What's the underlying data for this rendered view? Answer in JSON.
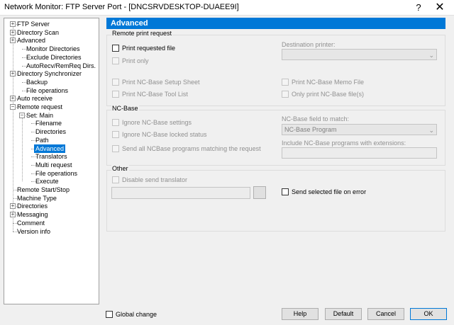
{
  "window": {
    "title": "Network Monitor: FTP Server Port - [DNCSRVDESKTOP-DUAEE9I]",
    "help_glyph": "?",
    "close_glyph": "✕"
  },
  "tree": {
    "items": [
      {
        "label": "FTP Server",
        "expander": "+"
      },
      {
        "label": "Directory Scan",
        "expander": "+"
      },
      {
        "label": "Advanced",
        "expander": "+"
      },
      {
        "label": "Monitor Directories"
      },
      {
        "label": "Exclude Directories"
      },
      {
        "label": "AutoRecv/RemReq Dirs."
      },
      {
        "label": "Directory Synchronizer",
        "expander": "+"
      },
      {
        "label": "Backup"
      },
      {
        "label": "File operations"
      },
      {
        "label": "Auto receive",
        "expander": "+"
      },
      {
        "label": "Remote request",
        "expander": "−"
      },
      {
        "label": "Set: Main",
        "expander": "−"
      },
      {
        "label": "Filename"
      },
      {
        "label": "Directories"
      },
      {
        "label": "Path"
      },
      {
        "label": "Advanced",
        "selected": true
      },
      {
        "label": "Translators"
      },
      {
        "label": "Multi request"
      },
      {
        "label": "File operations"
      },
      {
        "label": "Execute"
      },
      {
        "label": "Remote Start/Stop"
      },
      {
        "label": "Machine Type"
      },
      {
        "label": "Directories",
        "expander": "+"
      },
      {
        "label": "Messaging",
        "expander": "+"
      },
      {
        "label": "Comment"
      },
      {
        "label": "Version info"
      }
    ]
  },
  "panel": {
    "header": "Advanced",
    "remote_print": {
      "title": "Remote print request",
      "print_requested_file": "Print requested file",
      "print_only": "Print only",
      "destination_printer_label": "Destination printer:",
      "destination_printer_value": "",
      "print_setup_sheet": "Print NC-Base Setup Sheet",
      "print_memo_file": "Print NC-Base Memo File",
      "print_tool_list": "Print NC-Base Tool List",
      "only_print_files": "Only print NC-Base file(s)"
    },
    "nc_base": {
      "title": "NC-Base",
      "ignore_settings": "Ignore NC-Base settings",
      "ignore_locked": "Ignore NC-Base locked status",
      "send_all": "Send all NCBase programs matching the request",
      "field_label": "NC-Base field to match:",
      "field_value": "NC-Base Program",
      "extensions_label": "Include NC-Base programs with extensions:"
    },
    "other": {
      "title": "Other",
      "disable_translator": "Disable send translator",
      "send_on_error": "Send selected file on error"
    }
  },
  "footer": {
    "global_change": "Global change",
    "help": "Help",
    "default": "Default",
    "cancel": "Cancel",
    "ok": "OK"
  },
  "icons": {
    "dropdown_arrow": "⌄"
  }
}
